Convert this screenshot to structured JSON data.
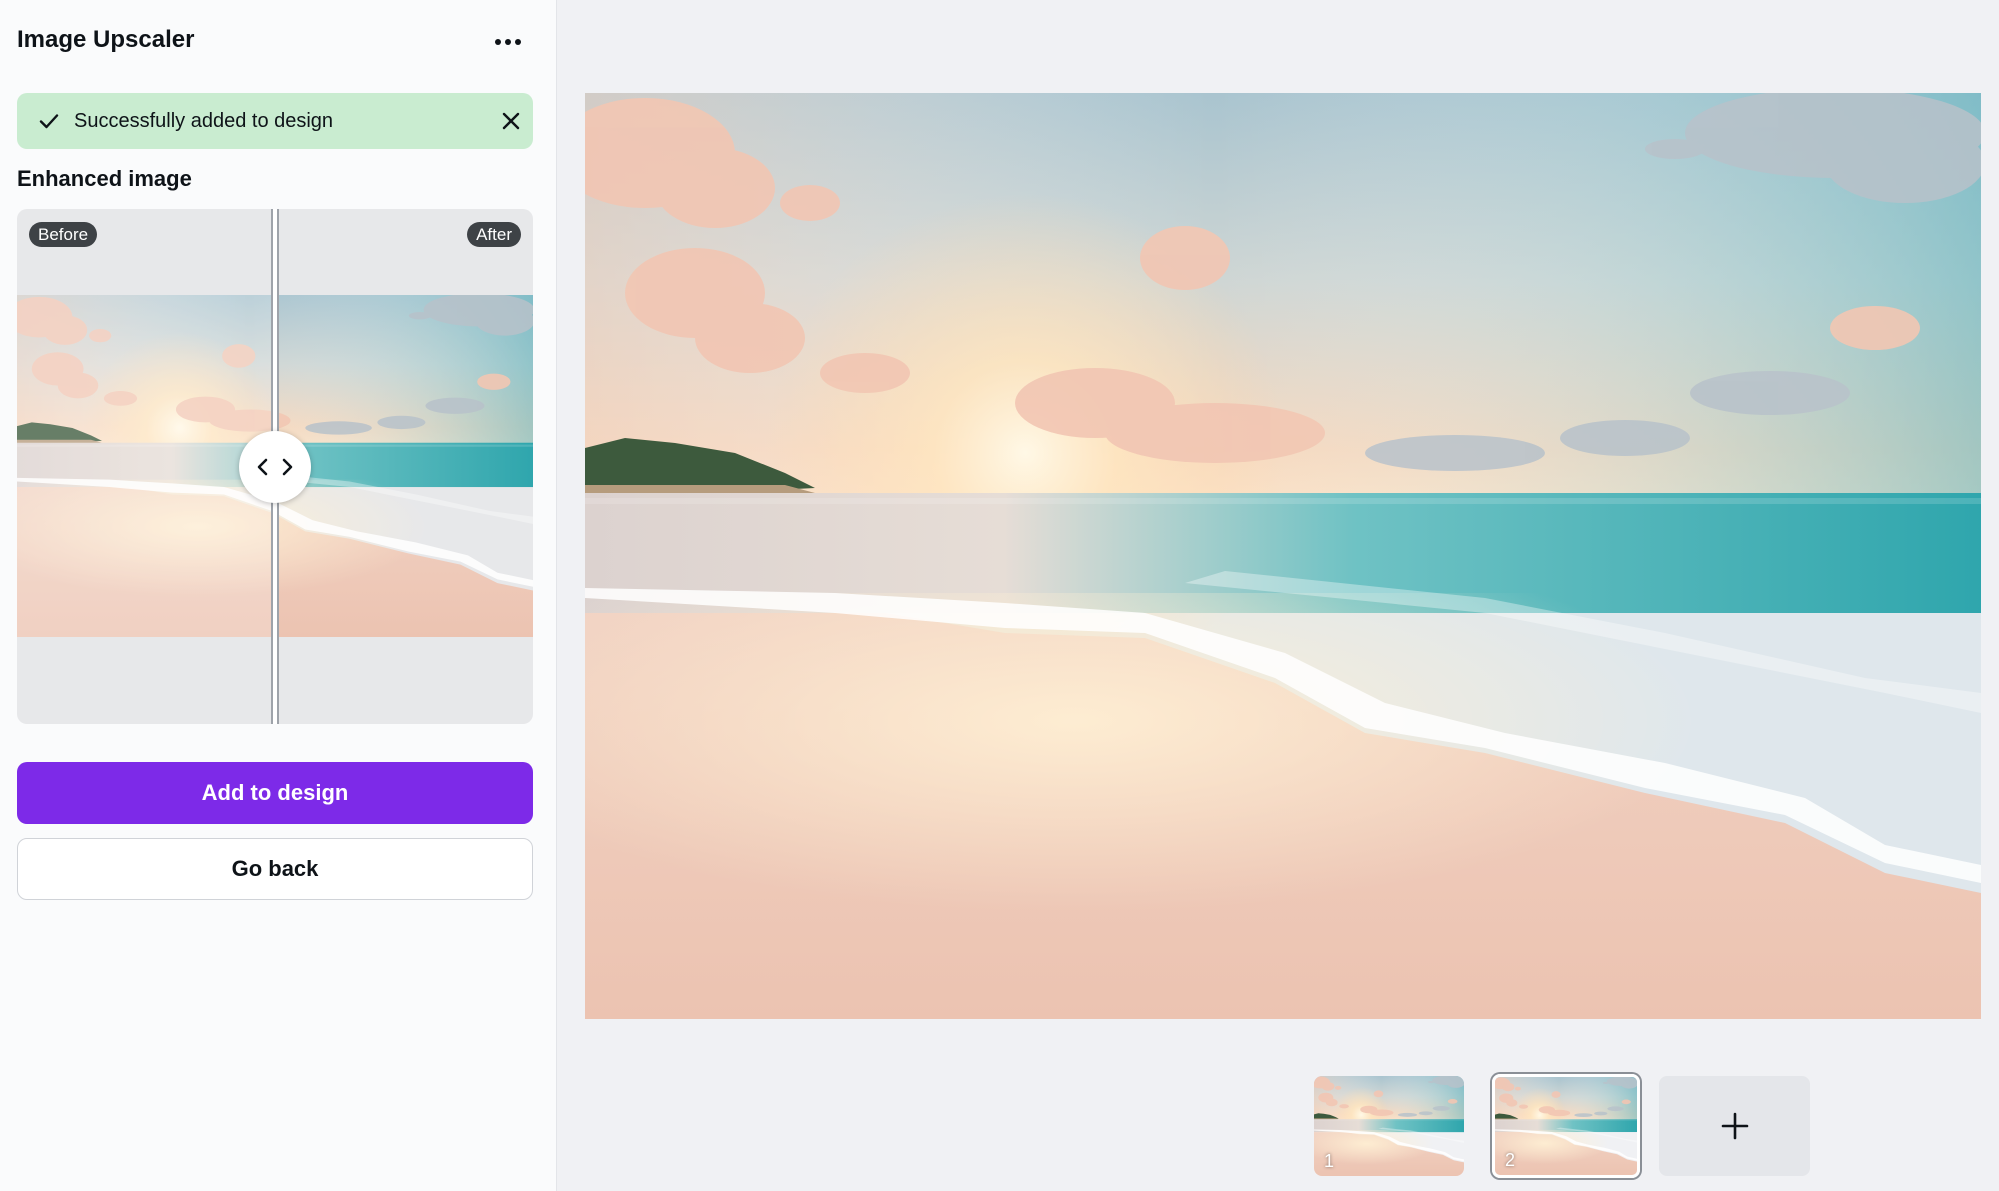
{
  "panel": {
    "title": "Image Upscaler",
    "more_icon": "more-horizontal-icon"
  },
  "toast": {
    "message": "Successfully added to design",
    "check_icon": "check-icon",
    "close_icon": "close-icon",
    "color": "#c9ecd0"
  },
  "enhanced": {
    "title": "Enhanced image",
    "before_label": "Before",
    "after_label": "After",
    "handle_icon": "chevron-left-right-icon"
  },
  "actions": {
    "add_label": "Add to design",
    "back_label": "Go back",
    "accent": "#7d2ae8"
  },
  "pages": {
    "items": [
      {
        "number": "1",
        "selected": false
      },
      {
        "number": "2",
        "selected": true
      }
    ],
    "add_icon": "plus-icon"
  }
}
